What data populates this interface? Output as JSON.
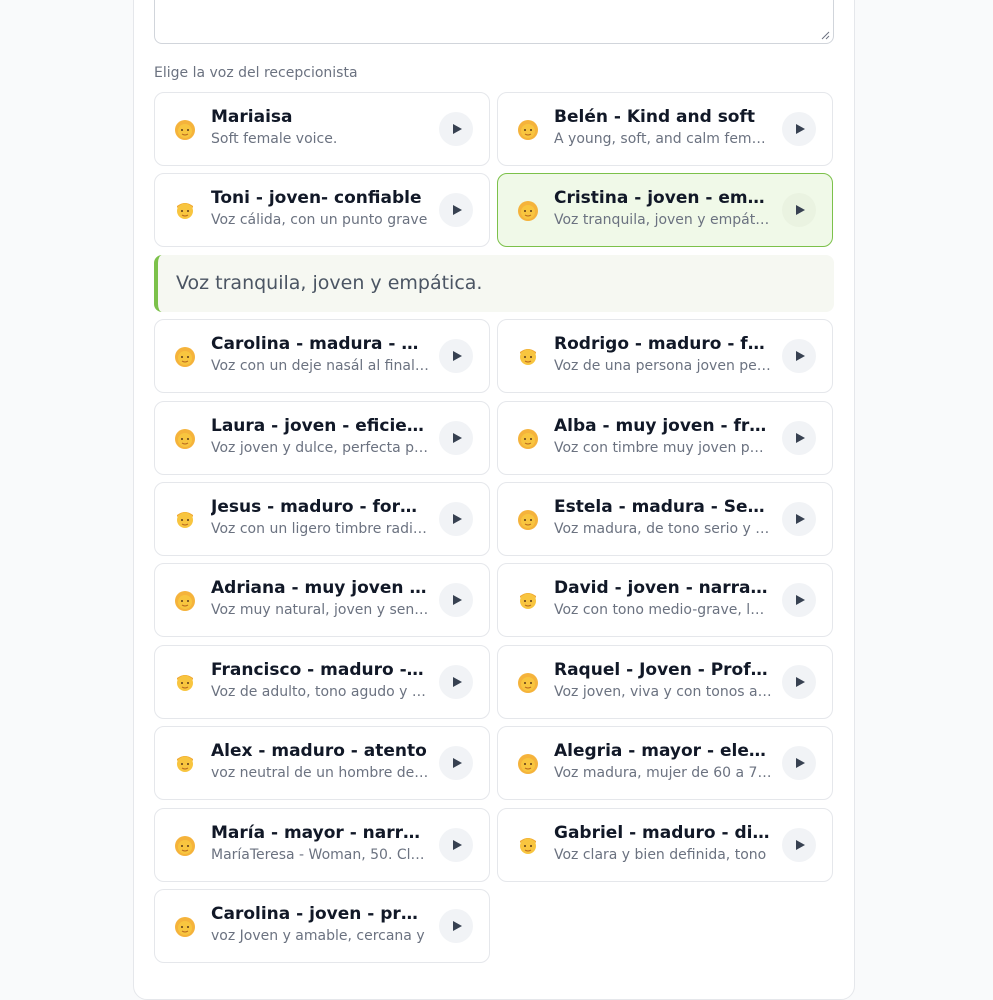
{
  "section_label": "Elige la voz del recepcionista",
  "selected_description": "Voz tranquila, joven y empática.",
  "colors": {
    "accent": "#7cc14a",
    "selected_bg": "#f0f9e8"
  },
  "voices": [
    {
      "name": "Mariaisa",
      "desc": "Soft female voice.",
      "avatar": "female-avatar-icon"
    },
    {
      "name": "Belén - Kind and soft",
      "desc": "A young, soft, and calm female voice.",
      "avatar": "female-avatar-icon"
    },
    {
      "name": "Toni - joven- confiable",
      "desc": "Voz cálida, con un punto grave",
      "avatar": "male-avatar-icon"
    },
    {
      "name": "Cristina - joven - empatía",
      "desc": "Voz tranquila, joven y empática.",
      "avatar": "female-avatar-icon",
      "selected": true
    },
    {
      "name": "Carolina - madura - Dinámica",
      "desc": "Voz con un deje nasál al finalizar",
      "avatar": "female-avatar-icon"
    },
    {
      "name": "Rodrigo - maduro - formal",
      "desc": "Voz de una persona joven pero madura",
      "avatar": "male-avatar-icon"
    },
    {
      "name": "Laura - joven - eficiente",
      "desc": "Voz joven y dulce, perfecta para",
      "avatar": "female-avatar-icon"
    },
    {
      "name": "Alba - muy joven - fresca",
      "desc": "Voz con timbre muy joven pero",
      "avatar": "female-avatar-icon"
    },
    {
      "name": "Jesus - maduro - formal",
      "desc": "Voz con un ligero timbre radiofónico",
      "avatar": "male-avatar-icon"
    },
    {
      "name": "Estela - madura - Seria",
      "desc": "Voz madura, de tono serio y algo",
      "avatar": "female-avatar-icon"
    },
    {
      "name": "Adriana - muy joven - alegre",
      "desc": "Voz muy natural, joven y sencilla",
      "avatar": "female-avatar-icon"
    },
    {
      "name": "David - joven - narrador",
      "desc": "Voz con tono medio-grave, locutor",
      "avatar": "male-avatar-icon"
    },
    {
      "name": "Francisco - maduro - directo",
      "desc": "Voz de adulto, tono agudo y rítmico",
      "avatar": "male-avatar-icon"
    },
    {
      "name": "Raquel - Joven - Profesional",
      "desc": "Voz joven, viva y con tonos agudos",
      "avatar": "female-avatar-icon"
    },
    {
      "name": "Alex - maduro - atento",
      "desc": "voz neutral de un hombre de mediana",
      "avatar": "male-avatar-icon"
    },
    {
      "name": "Alegria - mayor - elegante",
      "desc": "Voz madura, mujer de 60 a 70 años",
      "avatar": "female-avatar-icon"
    },
    {
      "name": "María - mayor - narradora",
      "desc": "MaríaTeresa - Woman, 50. Clear",
      "avatar": "female-avatar-icon"
    },
    {
      "name": "Gabriel - maduro - dinámico",
      "desc": "Voz clara y bien definida, tono",
      "avatar": "male-avatar-icon"
    },
    {
      "name": "Carolina - joven - profesional",
      "desc": "voz Joven y amable, cercana y",
      "avatar": "female-avatar-icon"
    }
  ]
}
